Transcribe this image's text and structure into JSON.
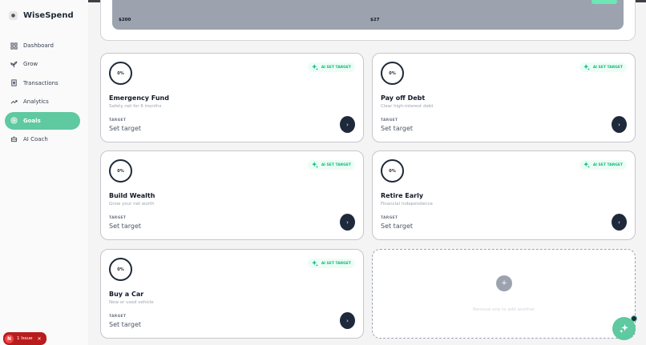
{
  "app": {
    "name": "WiseSpend"
  },
  "sidebar": {
    "items": [
      {
        "label": "Dashboard",
        "icon": "grid-icon",
        "active": false
      },
      {
        "label": "Grow",
        "icon": "sprout-icon",
        "active": false
      },
      {
        "label": "Transactions",
        "icon": "receipt-icon",
        "active": false
      },
      {
        "label": "Analytics",
        "icon": "trend-icon",
        "active": false
      },
      {
        "label": "Goals",
        "icon": "target-icon",
        "active": true
      },
      {
        "label": "AI Coach",
        "icon": "robot-icon",
        "active": false
      }
    ]
  },
  "summary": {
    "left_value": "$200",
    "right_value": "$27"
  },
  "goals": [
    {
      "progress": "0%",
      "ai_label": "AI SET TARGET",
      "title": "Emergency Fund",
      "subtitle": "Safety net for 6 months",
      "target_label": "TARGET",
      "target_value": "Set target"
    },
    {
      "progress": "0%",
      "ai_label": "AI SET TARGET",
      "title": "Pay off Debt",
      "subtitle": "Clear high-interest debt",
      "target_label": "TARGET",
      "target_value": "Set target"
    },
    {
      "progress": "0%",
      "ai_label": "AI SET TARGET",
      "title": "Build Wealth",
      "subtitle": "Grow your net worth",
      "target_label": "TARGET",
      "target_value": "Set target"
    },
    {
      "progress": "0%",
      "ai_label": "AI SET TARGET",
      "title": "Retire Early",
      "subtitle": "Financial independence",
      "target_label": "TARGET",
      "target_value": "Set target"
    },
    {
      "progress": "0%",
      "ai_label": "AI SET TARGET",
      "title": "Buy a Car",
      "subtitle": "New or used vehicle",
      "target_label": "TARGET",
      "target_value": "Set target"
    }
  ],
  "add_card": {
    "text": "Remove one to add another"
  },
  "issue_badge": {
    "initial": "N",
    "label": "1 Issue"
  },
  "colors": {
    "accent": "#5fc9a0",
    "dark_button": "#1e293b",
    "ai_badge": "#10b981"
  }
}
